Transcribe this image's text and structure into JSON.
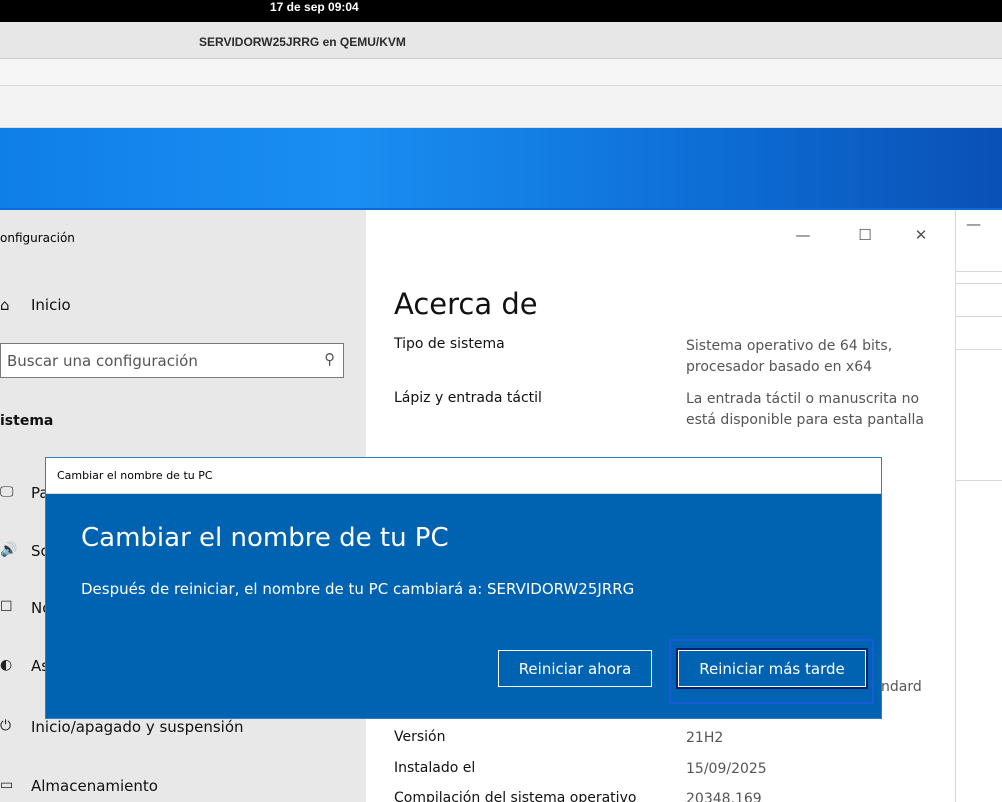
{
  "topbar": {
    "clock": "17 de sep  09:04"
  },
  "vm": {
    "title": "SERVIDORW25JRRG en QEMU/KVM"
  },
  "settings": {
    "window_title": "onfiguración",
    "home_icon": "home-icon",
    "home_label": "Inicio",
    "search_placeholder": "Buscar una configuración",
    "search_icon": "search-icon",
    "section": "istema",
    "nav_items": [
      {
        "icon": "display-icon",
        "label": "Pa"
      },
      {
        "icon": "sound-icon",
        "label": "So"
      },
      {
        "icon": "notifications-icon",
        "label": "No"
      },
      {
        "icon": "focus-assist-icon",
        "label": "As"
      },
      {
        "icon": "power-icon",
        "label": "Inicio/apagado y suspensión"
      },
      {
        "icon": "storage-icon",
        "label": "Almacenamiento"
      }
    ],
    "window_controls": {
      "minimize": "—",
      "maximize": "☐",
      "close": "✕"
    },
    "page_heading": "Acerca de",
    "specs": [
      {
        "label": "Tipo de sistema",
        "value": "Sistema operativo de 64 bits, procesador basado en x64"
      },
      {
        "label": "Lápiz y entrada táctil",
        "value": "La entrada táctil o manuscrita no está disponible para esta pantalla"
      },
      {
        "label": "",
        "value": "ndard"
      },
      {
        "label": "Versión",
        "value": "21H2"
      },
      {
        "label": "Instalado el",
        "value": "15/09/2025"
      },
      {
        "label": "Compilación del sistema operativo",
        "value": "20348.169"
      }
    ]
  },
  "edge_window": {
    "minimize": "—"
  },
  "dialog": {
    "window_title": "Cambiar el nombre de tu PC",
    "heading": "Cambiar el nombre de tu PC",
    "message": "Después de reiniciar, el nombre de tu PC cambiará a: SERVIDORW25JRRG",
    "restart_now": "Reiniciar ahora",
    "restart_later": "Reiniciar más tarde"
  },
  "colors": {
    "dialog_bg": "#0063b1",
    "focus_ring": "#1a5ad8",
    "wallpaper": "#0a6fd8"
  }
}
